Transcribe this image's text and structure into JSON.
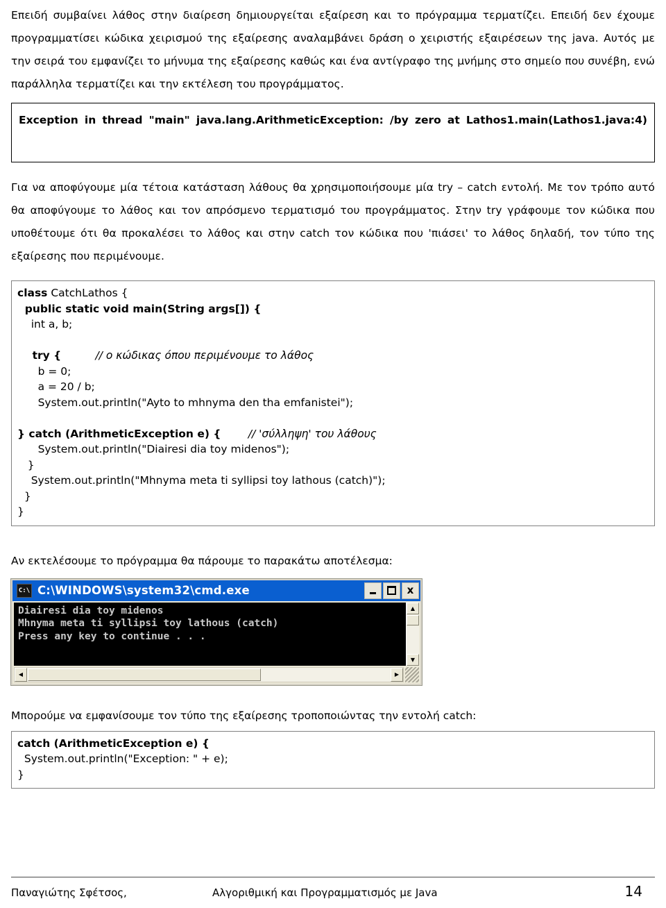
{
  "document": {
    "intro_paragraph": "Επειδή συμβαίνει λάθος στην διαίρεση δημιουργείται εξαίρεση και το πρόγραμμα τερματίζει. Επειδή δεν έχουμε προγραμματίσει κώδικα χειρισμού της εξαίρεσης αναλαμβάνει δράση ο χειριστής εξαιρέσεων της java. Αυτός με την σειρά του εμφανίζει το μήνυμα της εξαίρεσης καθώς και ένα αντίγραφο της μνήμης στο σημείο που συνέβη, ενώ παράλληλα τερματίζει και την εκτέλεση του προγράμματος.",
    "exception_output": "Exception in thread \"main\" java.lang.ArithmeticException: /by zero at Lathos1.main(Lathos1.java:4)",
    "try_catch_paragraph": "Για να αποφύγουμε μία τέτοια κατάσταση λάθους θα χρησιμοποιήσουμε μία try – catch εντολή. Με τον τρόπο αυτό θα αποφύγουμε το λάθος και τον απρόσμενο τερματισμό του προγράμματος. Στην try γράφουμε τον κώδικα που υποθέτουμε ότι θα προκαλέσει το λάθος και στην catch τον κώδικα που 'πιάσει' το λάθος δηλαδή,  τον τύπο της εξαίρεσης που περιμένουμε.",
    "result_lead": "Αν εκτελέσουμε το πρόγραμμα θα πάρουμε το παρακάτω αποτέλεσμα:",
    "modify_lead": "Μπορούμε να εμφανίσουμε τον τύπο της εξαίρεσης τροποποιώντας την εντολή catch:"
  },
  "code_main": {
    "lines": {
      "l1_kw": "class",
      "l1_rest": " CatchLathos {",
      "l2": "  public static void main(String args[]) {",
      "l3": "    int a, b;",
      "l4": "",
      "l5_kw": "    try {",
      "l5_cmt": "          // ο κώδικας όπου περιμένουμε το λάθος",
      "l6": "      b = 0;",
      "l7": "      a = 20 / b;",
      "l8": "      System.out.println(\"Ayto to mhnyma den tha emfanistei\");",
      "l9": "",
      "l10_kw": "} catch (ArithmeticException e) {",
      "l10_cmt": "        // 'σύλληψη' του λάθους",
      "l11": "      System.out.println(\"Diairesi dia toy midenos\");",
      "l12": "   }",
      "l13": "    System.out.println(\"Mhnyma meta ti syllipsi toy lathous (catch)\");",
      "l14": "  }",
      "l15": "}"
    }
  },
  "code_catch": {
    "line1": "catch (ArithmeticException e) {",
    "line2": "  System.out.println(\"Exception: \" + e);",
    "line3": "}"
  },
  "console": {
    "icon_label": "C:\\",
    "title": "C:\\WINDOWS\\system32\\cmd.exe",
    "minimize_label": "Minimize",
    "maximize_label": "Maximize",
    "close_label": "x",
    "output_lines": [
      "Diairesi dia toy midenos",
      "Mhnyma meta ti syllipsi toy lathous (catch)",
      "Press any key to continue . . ."
    ],
    "scroll_up_glyph": "▲",
    "scroll_down_glyph": "▼",
    "scroll_left_glyph": "◀",
    "scroll_right_glyph": "▶",
    "titlebar_color": "#0a5fd0",
    "screen_bg": "#000000",
    "screen_fg": "#c8c8c8"
  },
  "footer": {
    "author": "Παναγιώτης Σφέτσος,",
    "book_title": "Αλγοριθμική και Προγραμματισμός με Java",
    "page_number": "14"
  }
}
